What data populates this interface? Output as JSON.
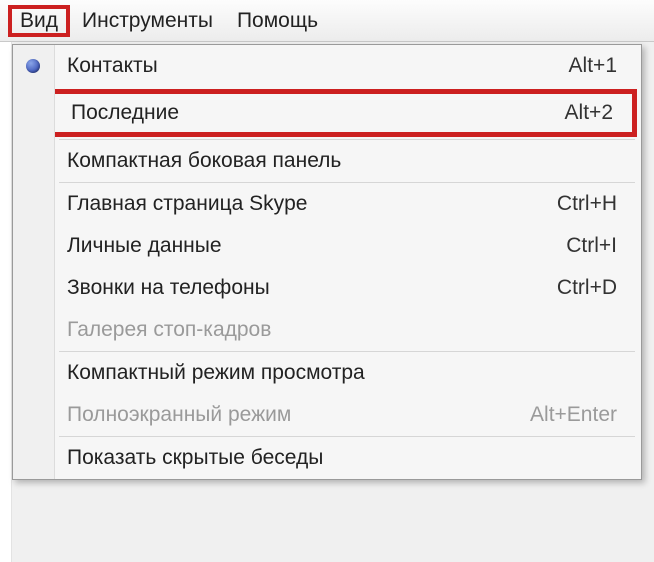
{
  "menubar": {
    "view": "Вид",
    "tools": "Инструменты",
    "help": "Помощь"
  },
  "menu": {
    "contacts": {
      "label": "Контакты",
      "shortcut": "Alt+1"
    },
    "recent": {
      "label": "Последние",
      "shortcut": "Alt+2"
    },
    "compact_sidebar": {
      "label": "Компактная боковая панель"
    },
    "skype_home": {
      "label": "Главная страница Skype",
      "shortcut": "Ctrl+H"
    },
    "profile": {
      "label": "Личные данные",
      "shortcut": "Ctrl+I"
    },
    "phone_calls": {
      "label": "Звонки на телефоны",
      "shortcut": "Ctrl+D"
    },
    "snapshot_gallery": {
      "label": "Галерея стоп-кадров"
    },
    "compact_view": {
      "label": "Компактный режим просмотра"
    },
    "fullscreen": {
      "label": "Полноэкранный режим",
      "shortcut": "Alt+Enter"
    },
    "hidden_chats": {
      "label": "Показать скрытые беседы"
    }
  }
}
